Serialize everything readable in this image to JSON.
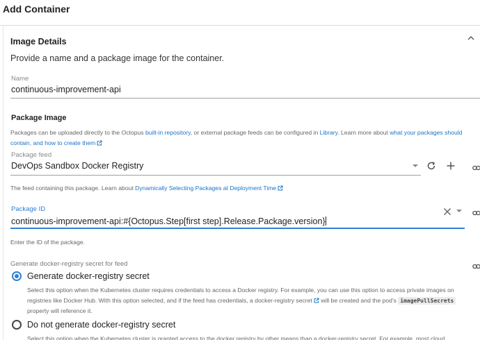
{
  "dialog": {
    "title": "Add Container"
  },
  "image_details": {
    "title": "Image Details",
    "description": "Provide a name and a package image for the container.",
    "name_field": {
      "label": "Name",
      "value": "continuous-improvement-api"
    },
    "package_image": {
      "title": "Package Image",
      "help": {
        "t1": "Packages can be uploaded directly to the Octopus ",
        "link1": "built-in repository",
        "t2": ", or external package feeds can be configured in ",
        "link2": "Library",
        "t3": ". Learn more about ",
        "link3": "what your packages should contain, and how to create them"
      }
    },
    "package_feed": {
      "label": "Package feed",
      "value": "DevOps Sandbox Docker Registry",
      "help_prefix": "The feed containing this package. Learn about ",
      "help_link": "Dynamically Selecting Packages at Deployment Time"
    },
    "package_id": {
      "label": "Package ID",
      "value": "continuous-improvement-api:#{Octopus.Step[first step].Release.Package.version}",
      "help": "Enter the ID of the package."
    },
    "registry_secret": {
      "label": "Generate docker-registry secret for feed",
      "option1": {
        "label": "Generate docker-registry secret",
        "desc1": "Select this option when the Kubernetes cluster requires credentials to access a Docker registry. For example, you can use this option to access private images on registries like Docker Hub. With this option selected, and if the feed has credentials, a ",
        "link": "docker-registry secret",
        "desc2": " will be created and the pod's ",
        "code": "imagePullSecrets",
        "desc3": " property will reference it."
      },
      "option2": {
        "label": "Do not generate docker-registry secret",
        "desc": "Select this option when the Kubernetes cluster is granted access to the docker registry by other means than a docker-registry secret. For example, most cloud"
      }
    }
  },
  "colors": {
    "accent": "#2f80d1",
    "link": "#1a73c8"
  }
}
